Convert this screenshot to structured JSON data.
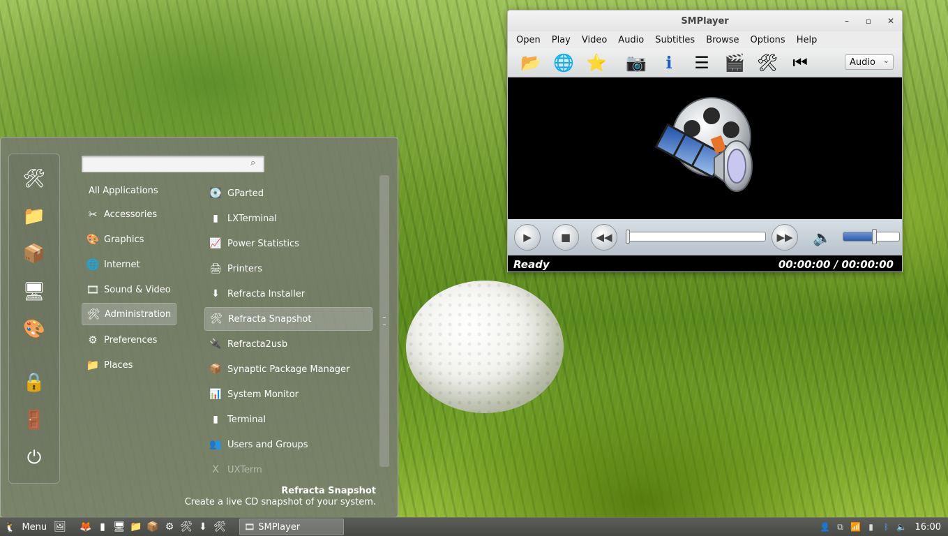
{
  "desktop": {
    "wallpaper": "golf ball in grass"
  },
  "menu": {
    "search": {
      "value": "",
      "placeholder": ""
    },
    "favorites": [
      {
        "icon": "tools-icon",
        "glyph": "🛠"
      },
      {
        "icon": "folder-icon",
        "glyph": "📁"
      },
      {
        "icon": "package-icon",
        "glyph": "📦"
      },
      {
        "icon": "monitor-icon",
        "glyph": "🖥"
      },
      {
        "icon": "color-palette-icon",
        "glyph": "🎨"
      },
      {
        "icon": "screensaver-lock-icon",
        "glyph": "🔒"
      },
      {
        "icon": "logout-icon",
        "glyph": "🚪"
      },
      {
        "icon": "shutdown-icon",
        "glyph": "⏻"
      }
    ],
    "categories": [
      {
        "label": "All Applications",
        "glyph": ""
      },
      {
        "label": "Accessories",
        "glyph": "✂"
      },
      {
        "label": "Graphics",
        "glyph": "🎨"
      },
      {
        "label": "Internet",
        "glyph": "🌐"
      },
      {
        "label": "Sound & Video",
        "glyph": "🎞"
      },
      {
        "label": "Administration",
        "glyph": "🛠"
      },
      {
        "label": "Preferences",
        "glyph": "⚙"
      },
      {
        "label": "Places",
        "glyph": "📁"
      }
    ],
    "selected_category": "Administration",
    "apps": [
      {
        "label": "GParted",
        "glyph": "💽"
      },
      {
        "label": "LXTerminal",
        "glyph": "▮"
      },
      {
        "label": "Power Statistics",
        "glyph": "📈"
      },
      {
        "label": "Printers",
        "glyph": "🖨"
      },
      {
        "label": "Refracta Installer",
        "glyph": "⬇"
      },
      {
        "label": "Refracta Snapshot",
        "glyph": "🛠"
      },
      {
        "label": "Refracta2usb",
        "glyph": "🔌"
      },
      {
        "label": "Synaptic Package Manager",
        "glyph": "📦"
      },
      {
        "label": "System Monitor",
        "glyph": "📊"
      },
      {
        "label": "Terminal",
        "glyph": "▮"
      },
      {
        "label": "Users and Groups",
        "glyph": "👥"
      },
      {
        "label": "UXTerm",
        "glyph": "X"
      }
    ],
    "selected_app": "Refracta Snapshot",
    "description": {
      "title": "Refracta Snapshot",
      "text": "Create a live CD snapshot of your system."
    }
  },
  "smplayer": {
    "title": "SMPlayer",
    "menu": [
      "Open",
      "Play",
      "Video",
      "Audio",
      "Subtitles",
      "Browse",
      "Options",
      "Help"
    ],
    "toolbar": [
      {
        "icon": "open-folder-icon",
        "glyph": "📂"
      },
      {
        "icon": "globe-icon",
        "glyph": "🌐"
      },
      {
        "icon": "favorites-star-icon",
        "glyph": "⭐"
      },
      {
        "icon": "screenshot-camera-icon",
        "glyph": "📷"
      },
      {
        "icon": "info-icon",
        "glyph": "ℹ"
      },
      {
        "icon": "playlist-icon",
        "glyph": "☰"
      },
      {
        "icon": "video-icon",
        "glyph": "🎬"
      },
      {
        "icon": "preferences-tools-icon",
        "glyph": "🛠"
      },
      {
        "icon": "previous-icon",
        "glyph": "⏮"
      }
    ],
    "audio_select": "Audio",
    "status": "Ready",
    "time": "00:00:00 / 00:00:00",
    "progress": 0,
    "volume": 0.55
  },
  "taskbar": {
    "menu_label": "Menu",
    "launchers": [
      {
        "icon": "show-desktop-icon",
        "glyph": "🖼"
      },
      {
        "icon": "firefox-icon",
        "glyph": "🦊"
      },
      {
        "icon": "terminal-icon",
        "glyph": "▮"
      },
      {
        "icon": "monitor-icon",
        "glyph": "🖥"
      },
      {
        "icon": "files-icon",
        "glyph": "📁"
      },
      {
        "icon": "synaptic-icon",
        "glyph": "📦"
      },
      {
        "icon": "settings-icon",
        "glyph": "⚙"
      },
      {
        "icon": "tools-icon",
        "glyph": "🛠"
      },
      {
        "icon": "installer-icon",
        "glyph": "⬇"
      },
      {
        "icon": "snapshot-icon",
        "glyph": "🛠"
      }
    ],
    "task": {
      "label": "SMPlayer"
    },
    "tray": [
      {
        "icon": "user-icon",
        "glyph": "👤"
      },
      {
        "icon": "clipboard-icon",
        "glyph": "⧉"
      },
      {
        "icon": "network-wifi-icon",
        "glyph": "📶"
      },
      {
        "icon": "battery-icon",
        "glyph": "▮"
      },
      {
        "icon": "bluetooth-icon",
        "glyph": "ᛒ"
      },
      {
        "icon": "volume-icon",
        "glyph": "🔈"
      }
    ],
    "clock": "16:00"
  }
}
